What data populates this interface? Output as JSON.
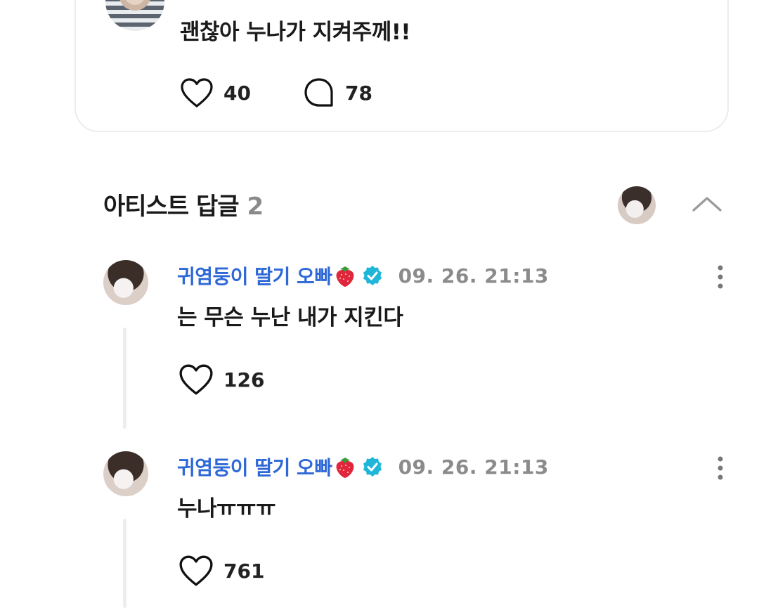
{
  "post": {
    "text": "괜찮아 누나가 지켜주께!!",
    "likes": "40",
    "comments": "78"
  },
  "artist_replies": {
    "title": "아티스트 답글",
    "count": "2"
  },
  "replies": [
    {
      "author": "귀염둥이 딸기 오빠",
      "timestamp": "09. 26. 21:13",
      "text": "는 무슨 누난 내가 지킨다",
      "likes": "126"
    },
    {
      "author": "귀염둥이 딸기 오빠",
      "timestamp": "09. 26. 21:13",
      "text": "누나ㅠㅠㅠ",
      "likes": "761"
    }
  ],
  "colors": {
    "author": "#2e68d6",
    "verified": "#1fb6d9",
    "muted": "#8b8b8b"
  },
  "icons": [
    "heart-icon",
    "comment-bubble-icon",
    "chevron-up-icon",
    "more-vertical-icon",
    "strawberry-icon",
    "verified-badge-icon"
  ]
}
